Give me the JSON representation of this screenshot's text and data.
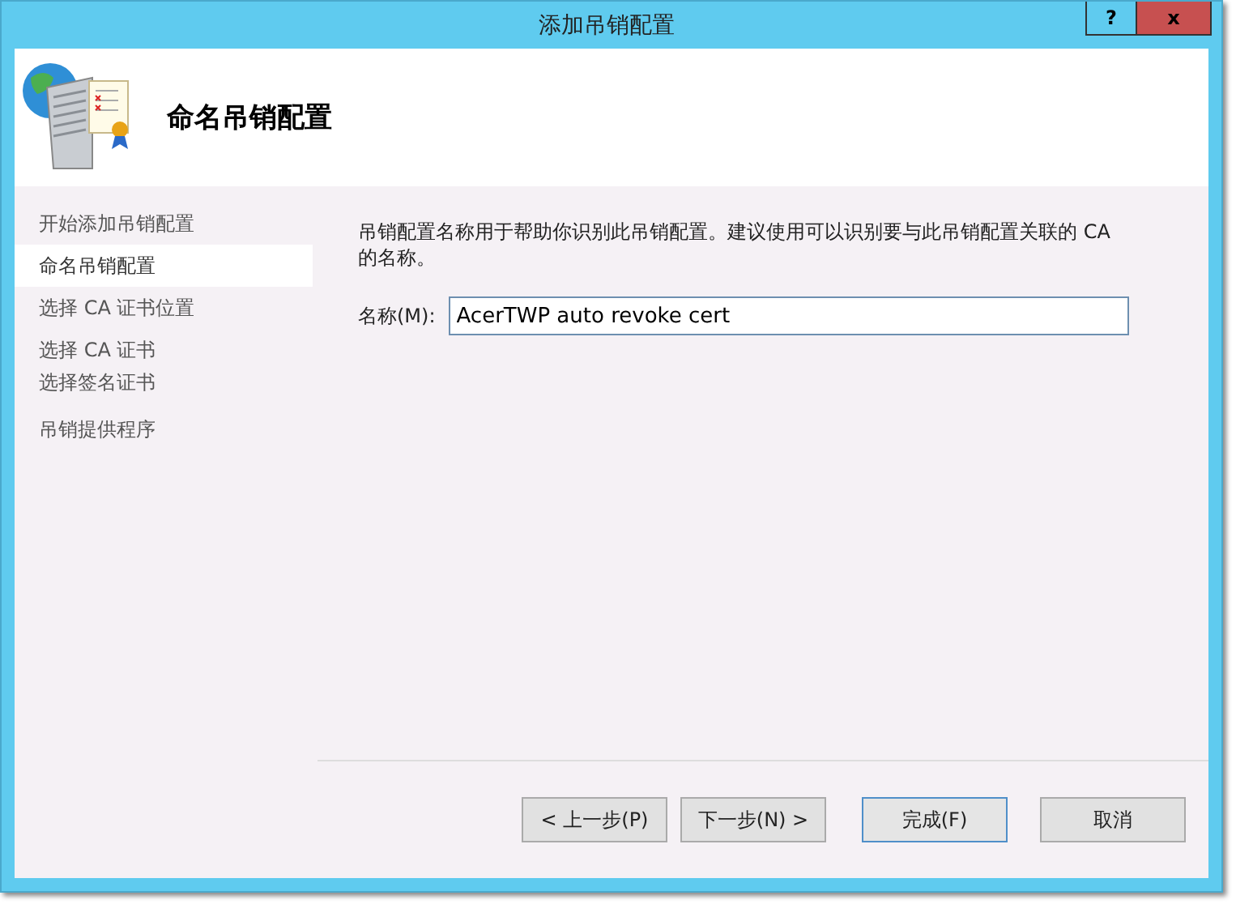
{
  "window": {
    "title": "添加吊销配置",
    "help_button": "?",
    "close_button": "x"
  },
  "header": {
    "title": "命名吊销配置"
  },
  "sidebar": {
    "items": [
      {
        "label": "开始添加吊销配置",
        "selected": false
      },
      {
        "label": "命名吊销配置",
        "selected": true
      },
      {
        "label": "选择 CA 证书位置",
        "selected": false
      },
      {
        "label": "选择 CA 证书",
        "selected": false
      },
      {
        "label": "选择签名证书",
        "selected": false
      },
      {
        "label": "吊销提供程序",
        "selected": false
      }
    ]
  },
  "content": {
    "description": "吊销配置名称用于帮助你识别此吊销配置。建议使用可以识别要与此吊销配置关联的 CA 的名称。",
    "name_label": "名称(M):",
    "name_value": "AcerTWP auto revoke cert"
  },
  "buttons": [
    {
      "label": "< 上一步(P)",
      "default": false
    },
    {
      "label": "下一步(N) >",
      "default": false
    },
    {
      "label": "完成(F)",
      "default": true
    },
    {
      "label": "取消",
      "default": false
    }
  ]
}
